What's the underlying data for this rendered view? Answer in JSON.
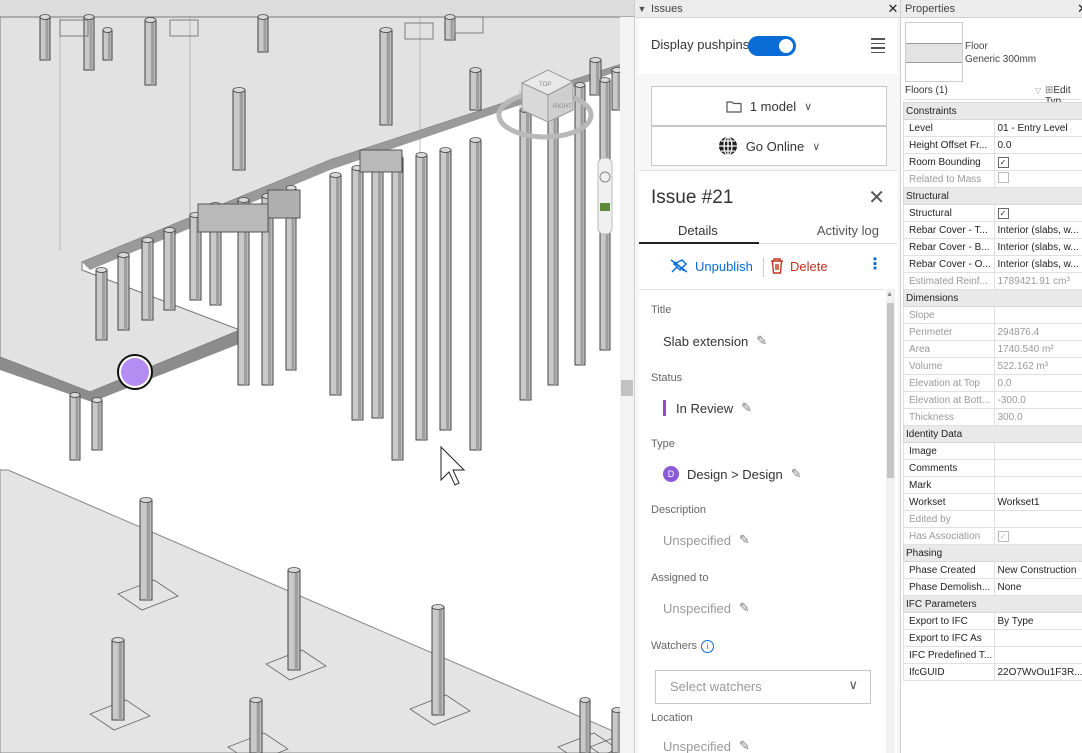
{
  "issues_panel": {
    "title": "Issues",
    "display_pushpins_label": "Display pushpins",
    "display_pushpins_on": true,
    "model_button": "1 model",
    "online_button": "Go Online",
    "issue": {
      "title": "Issue #21",
      "tabs": [
        "Details",
        "Activity log"
      ],
      "active_tab": "Details",
      "actions": {
        "unpublish": "Unpublish",
        "delete": "Delete"
      },
      "fields": {
        "title_label": "Title",
        "title_value": "Slab extension",
        "status_label": "Status",
        "status_value": "In Review",
        "type_label": "Type",
        "type_badge": "D",
        "type_value": "Design > Design",
        "description_label": "Description",
        "description_value": "Unspecified",
        "assigned_label": "Assigned to",
        "assigned_value": "Unspecified",
        "watchers_label": "Watchers",
        "watchers_placeholder": "Select watchers",
        "location_label": "Location",
        "location_value": "Unspecified"
      }
    }
  },
  "properties_panel": {
    "title": "Properties",
    "type_name_line1": "Floor",
    "type_name_line2": "Generic 300mm",
    "selector": "Floors (1)",
    "edit_type": "Edit Typ",
    "rows": [
      {
        "group": "Constraints"
      },
      {
        "k": "Level",
        "v": "01 - Entry Level"
      },
      {
        "k": "Height Offset Fr...",
        "v": "0.0"
      },
      {
        "k": "Room Bounding",
        "v": "",
        "check": true
      },
      {
        "k": "Related to Mass",
        "v": "",
        "check": false,
        "disabled": true
      },
      {
        "group": "Structural"
      },
      {
        "k": "Structural",
        "v": "",
        "check": true
      },
      {
        "k": "Rebar Cover - T...",
        "v": "Interior (slabs, w..."
      },
      {
        "k": "Rebar Cover - B...",
        "v": "Interior (slabs, w..."
      },
      {
        "k": "Rebar Cover - O...",
        "v": "Interior (slabs, w..."
      },
      {
        "k": "Estimated Reinf...",
        "v": "1789421.91 cm³",
        "disabled": true
      },
      {
        "group": "Dimensions"
      },
      {
        "k": "Slope",
        "v": "",
        "disabled": true
      },
      {
        "k": "Perimeter",
        "v": "294876.4",
        "disabled": true
      },
      {
        "k": "Area",
        "v": "1740.540 m²",
        "disabled": true
      },
      {
        "k": "Volume",
        "v": "522.162 m³",
        "disabled": true
      },
      {
        "k": "Elevation at Top",
        "v": "0.0",
        "disabled": true
      },
      {
        "k": "Elevation at Bott...",
        "v": "-300.0",
        "disabled": true
      },
      {
        "k": "Thickness",
        "v": "300.0",
        "disabled": true
      },
      {
        "group": "Identity Data"
      },
      {
        "k": "Image",
        "v": ""
      },
      {
        "k": "Comments",
        "v": ""
      },
      {
        "k": "Mark",
        "v": ""
      },
      {
        "k": "Workset",
        "v": "Workset1"
      },
      {
        "k": "Edited by",
        "v": "",
        "disabled": true
      },
      {
        "k": "Has Association",
        "v": "",
        "check": true,
        "disabled": true
      },
      {
        "group": "Phasing"
      },
      {
        "k": "Phase Created",
        "v": "New Construction"
      },
      {
        "k": "Phase Demolish...",
        "v": "None"
      },
      {
        "group": "IFC Parameters"
      },
      {
        "k": "Export to IFC",
        "v": "By Type"
      },
      {
        "k": "Export to IFC As",
        "v": ""
      },
      {
        "k": "IFC Predefined T...",
        "v": ""
      },
      {
        "k": "IfcGUID",
        "v": "22O7WvOu1F3R..."
      }
    ]
  },
  "viewcube": {
    "faces": [
      "TOP",
      "RIGHT"
    ]
  },
  "colors": {
    "accent": "#0a6cd6",
    "pushpin": "#b58cf2",
    "status": "#8a4fd0",
    "delete": "#c2321f"
  }
}
